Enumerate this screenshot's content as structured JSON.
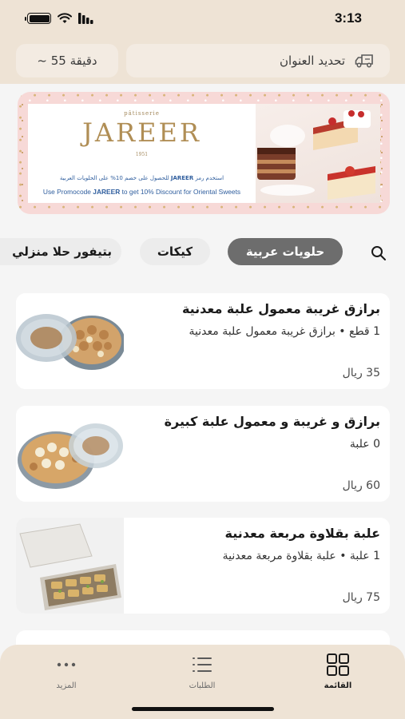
{
  "status_bar": {
    "time": "3:13"
  },
  "header": {
    "address_label": "تحديد العنوان",
    "delivery_time": "~ 55 دقيقة"
  },
  "banner": {
    "patisserie": "pâtisserie",
    "brand": "JAREER",
    "year": "1951",
    "promo_ar_pre": "استخدم رمز",
    "promo_code": "JAREER",
    "promo_ar_post": "للحصول على خصم 10% على الحلويات العربية",
    "promo_en_pre": "Use Promocode",
    "promo_en_post": "to get 10% Discount for Oriental Sweets"
  },
  "categories": [
    {
      "label": "حلويات عربية",
      "active": true
    },
    {
      "label": "كيكات",
      "active": false
    },
    {
      "label": "بتيفور حلا منزلي",
      "active": false
    }
  ],
  "products": [
    {
      "title": "برازق غريبة معمول علبة معدنية",
      "desc": "1 قطع • برازق غريبة معمول علبة معدنية",
      "price": "35 ريال"
    },
    {
      "title": "برازق و غريبة و معمول علبة كبيرة",
      "desc": "0 علبة",
      "price": "60 ريال"
    },
    {
      "title": "علبة بقلاوة مربعة معدنية",
      "desc": "1 علبة • علبة بقلاوة مربعة معدنية",
      "price": "75 ريال"
    }
  ],
  "tabbar": {
    "menu": "القائمة",
    "orders": "الطلبات",
    "more": "المزيد"
  },
  "colors": {
    "header_bg": "#eee3d5",
    "active_chip": "#6d6d6d",
    "banner_bg": "#f7d9d7"
  }
}
